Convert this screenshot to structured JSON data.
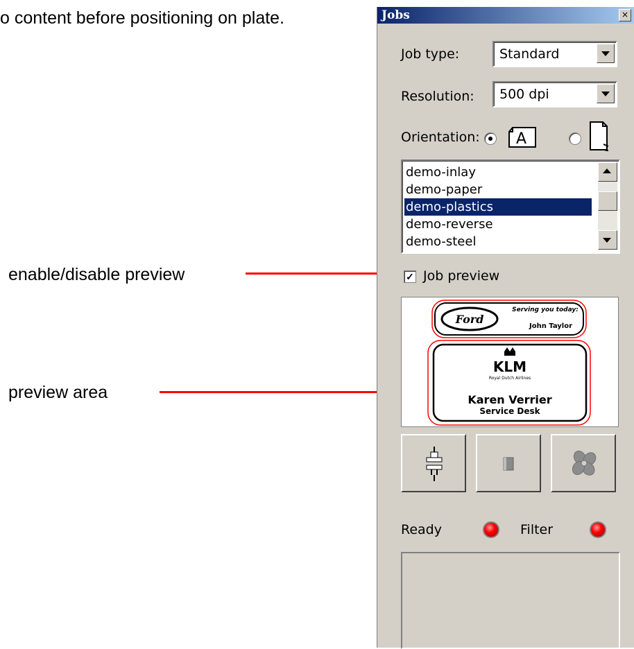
{
  "document": {
    "top_text": "o content before positioning on plate.",
    "annotation_preview_toggle": "enable/disable preview",
    "annotation_preview_area": "preview area"
  },
  "panel": {
    "title": "Jobs",
    "close_glyph": "×",
    "job_type": {
      "label": "Job type:",
      "value": "Standard"
    },
    "resolution": {
      "label": "Resolution:",
      "value": "500 dpi"
    },
    "orientation": {
      "label": "Orientation:",
      "options": [
        {
          "name": "landscape",
          "glyph": "A",
          "selected": true
        },
        {
          "name": "portrait",
          "glyph": "A",
          "selected": false
        }
      ]
    },
    "job_list": {
      "items": [
        "demo-inlay",
        "demo-paper",
        "demo-plastics",
        "demo-reverse",
        "demo-steel"
      ],
      "selected_index": 2
    },
    "job_preview": {
      "label": "Job preview",
      "checked": true
    },
    "preview": {
      "label1": {
        "brand": "Ford",
        "line1": "Serving you today:",
        "line2": "John Taylor"
      },
      "label2": {
        "brand": "KLM",
        "tagline": "Royal Dutch Airlines",
        "name": "Karen Verrier",
        "role": "Service Desk"
      }
    },
    "toolbar": {
      "connect_icon": "plug-connect-icon",
      "page_icon": "page-icon",
      "fan_icon": "fan-icon"
    },
    "status": {
      "ready_label": "Ready",
      "filter_label": "Filter",
      "ready_color": "#ff0000",
      "filter_color": "#ff0000"
    }
  }
}
